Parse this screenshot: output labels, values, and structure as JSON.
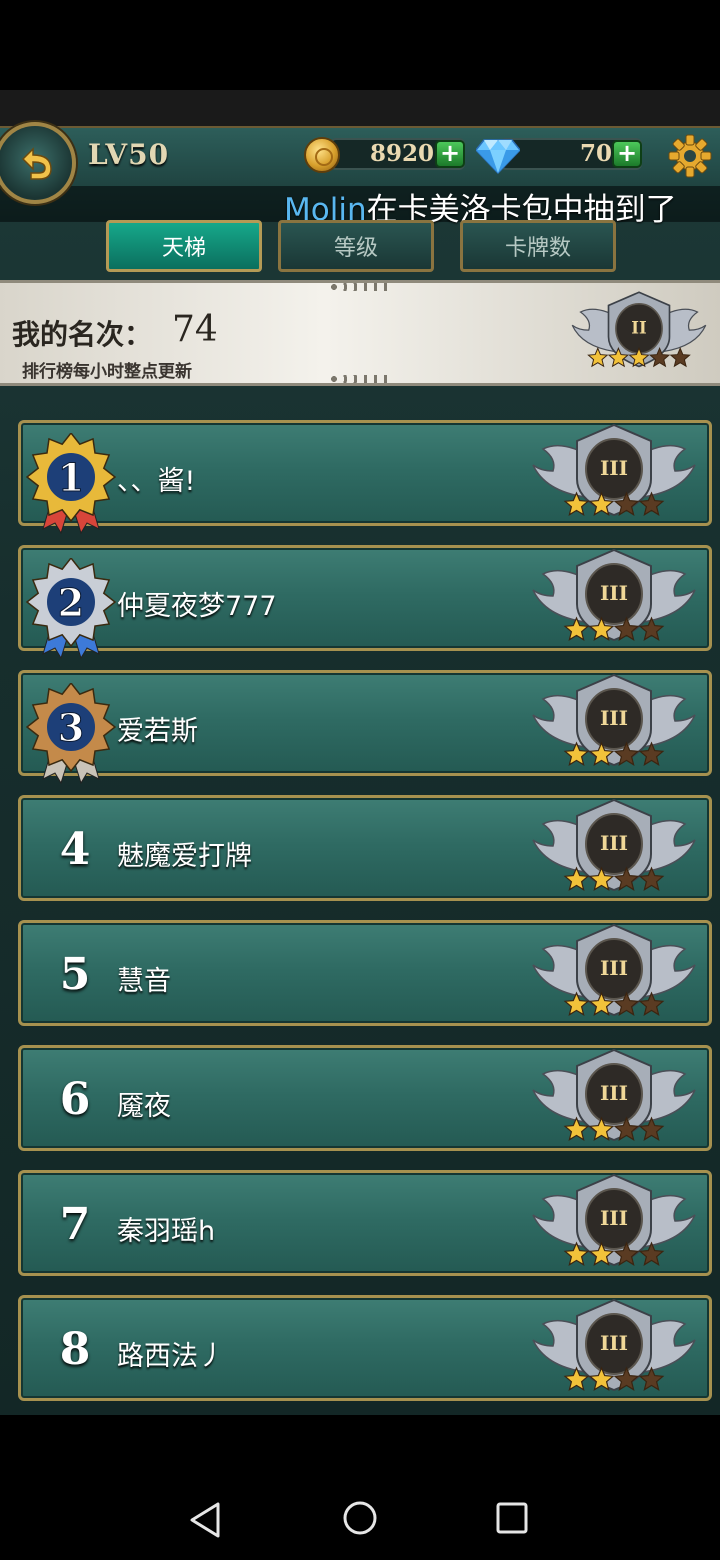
{
  "header": {
    "level": "LV50",
    "gold": "8920",
    "gems": "70",
    "ticker_name": "Molin",
    "ticker_text": "在卡美洛卡包中抽到了"
  },
  "tabs": [
    {
      "label": "天梯",
      "active": true
    },
    {
      "label": "等级",
      "active": false
    },
    {
      "label": "卡牌数",
      "active": false
    }
  ],
  "my_rank": {
    "label": "我的名次：",
    "value": "74",
    "note": "排行榜每小时整点更新",
    "tier": "II",
    "stars_filled": 3,
    "stars_total": 5
  },
  "leaderboard": [
    {
      "rank": "1",
      "name": "、、酱!",
      "tier": "III",
      "stars_filled": 2,
      "stars_total": 4
    },
    {
      "rank": "2",
      "name": "仲夏夜梦777",
      "tier": "III",
      "stars_filled": 2,
      "stars_total": 4
    },
    {
      "rank": "3",
      "name": "爱若斯",
      "tier": "III",
      "stars_filled": 2,
      "stars_total": 4
    },
    {
      "rank": "4",
      "name": "魅魔爱打牌",
      "tier": "III",
      "stars_filled": 2,
      "stars_total": 4
    },
    {
      "rank": "5",
      "name": "慧音",
      "tier": "III",
      "stars_filled": 2,
      "stars_total": 4
    },
    {
      "rank": "6",
      "name": "魇夜",
      "tier": "III",
      "stars_filled": 2,
      "stars_total": 4
    },
    {
      "rank": "7",
      "name": "秦羽瑶h",
      "tier": "III",
      "stars_filled": 2,
      "stars_total": 4
    },
    {
      "rank": "8",
      "name": "路西法丿",
      "tier": "III",
      "stars_filled": 2,
      "stars_total": 4
    }
  ],
  "colors": {
    "medal_gold": "#e8b93a",
    "medal_silver": "#c9ced6",
    "medal_bronze": "#c48a4a",
    "star_filled": "#f2c23a",
    "star_empty": "#5a3b22"
  }
}
